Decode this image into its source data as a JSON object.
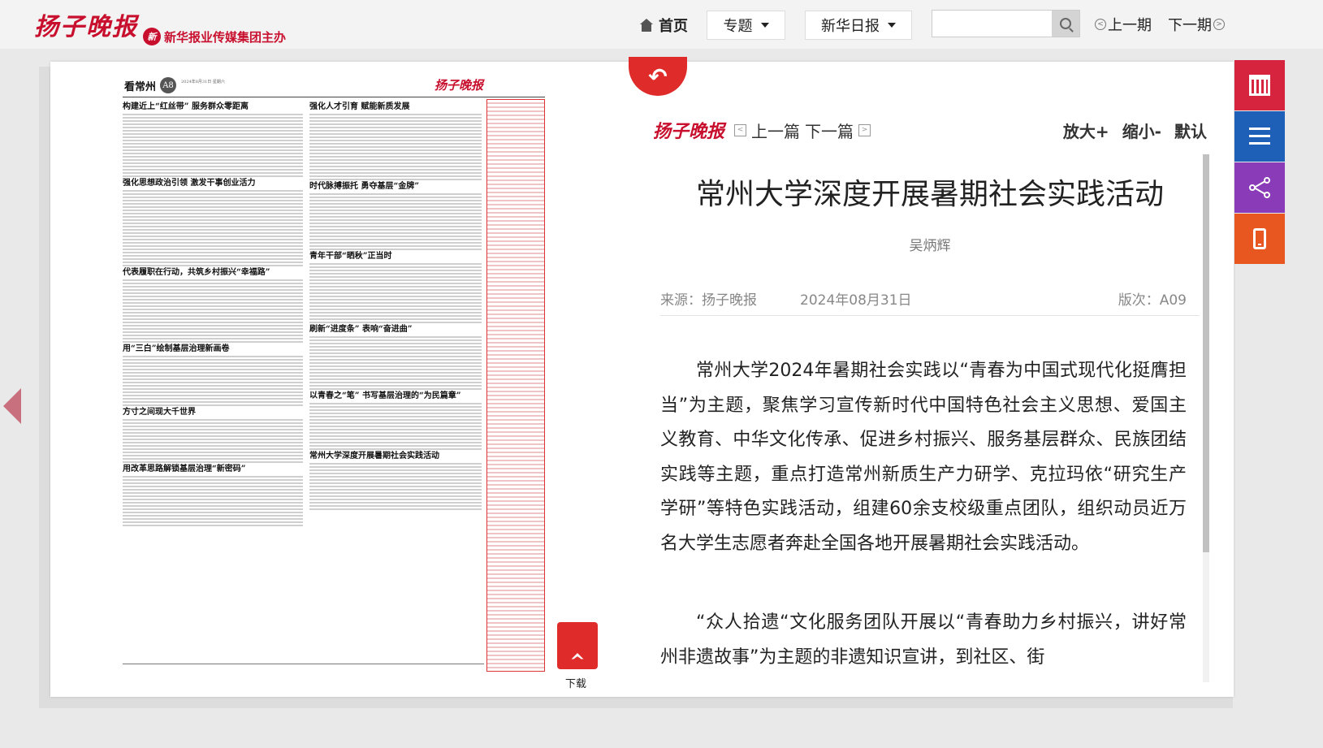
{
  "header": {
    "logo_text": "扬子晚报",
    "sub_logo_text": "新华报业传媒集团主办",
    "nav_home": "首页",
    "topic_dropdown": "专题",
    "paper_dropdown": "新华日报",
    "search_placeholder": "",
    "prev_issue": "上一期",
    "next_issue": "下一期"
  },
  "newspaper": {
    "section": "看常州",
    "page": "A8",
    "date_line": "2024年8月31日 星期六",
    "logo_text": "扬子晚报",
    "headlines": [
      "构建近上“红丝带” 服务群众零距离",
      "强化思想政治引领 激发干事创业活力",
      "代表履职在行动，共筑乡村振兴“幸福路”",
      "用“三白”绘制基层治理新画卷",
      "方寸之间现大千世界",
      "用改革思路解锁基层治理“新密码”",
      "强化人才引育 赋能新质发展",
      "时代脉搏振托 勇夺基层“金牌”",
      "青年干部“晒秋”正当时",
      "刷新“进度条” 表响“奋进曲”",
      "以青春之“笔” 书写基层治理的“为民篇章”",
      "常州大学深度开展暑期社会实践活动"
    ],
    "download_label": "下载"
  },
  "article": {
    "logo_text": "扬子晚报",
    "prev_article": "上一篇",
    "next_article": "下一篇",
    "zoom_in": "放大+",
    "zoom_out": "缩小-",
    "default": "默认",
    "title": "常州大学深度开展暑期社会实践活动",
    "author": "吴炳辉",
    "source": "来源：扬子晚报",
    "date": "2024年08月31日",
    "page": "版次：A09",
    "paragraphs": [
      "常州大学2024年暑期社会实践以“青春为中国式现代化挺膺担当”为主题，聚焦学习宣传新时代中国特色社会主义思想、爱国主义教育、中华文化传承、促进乡村振兴、服务基层群众、民族团结实践等主题，重点打造常州新质生产力研学、克拉玛依“研究生产学研”等特色实践活动，组建60余支校级重点团队，组织动员近万名大学生志愿者奔赴全国各地开展暑期社会实践活动。",
      "“众人拾遗“文化服务团队开展以“青春助力乡村振兴，讲好常州非遗故事”为主题的非遗知识宣讲，到社区、街"
    ]
  },
  "side_icons": [
    "calendar-icon",
    "list-icon",
    "share-icon",
    "mobile-icon"
  ],
  "colors": {
    "brand_red": "#c8102e",
    "side_calendar": "#d6243f",
    "side_list": "#1e5fb7",
    "side_share": "#8a3bb8",
    "side_mobile": "#e8571f"
  }
}
